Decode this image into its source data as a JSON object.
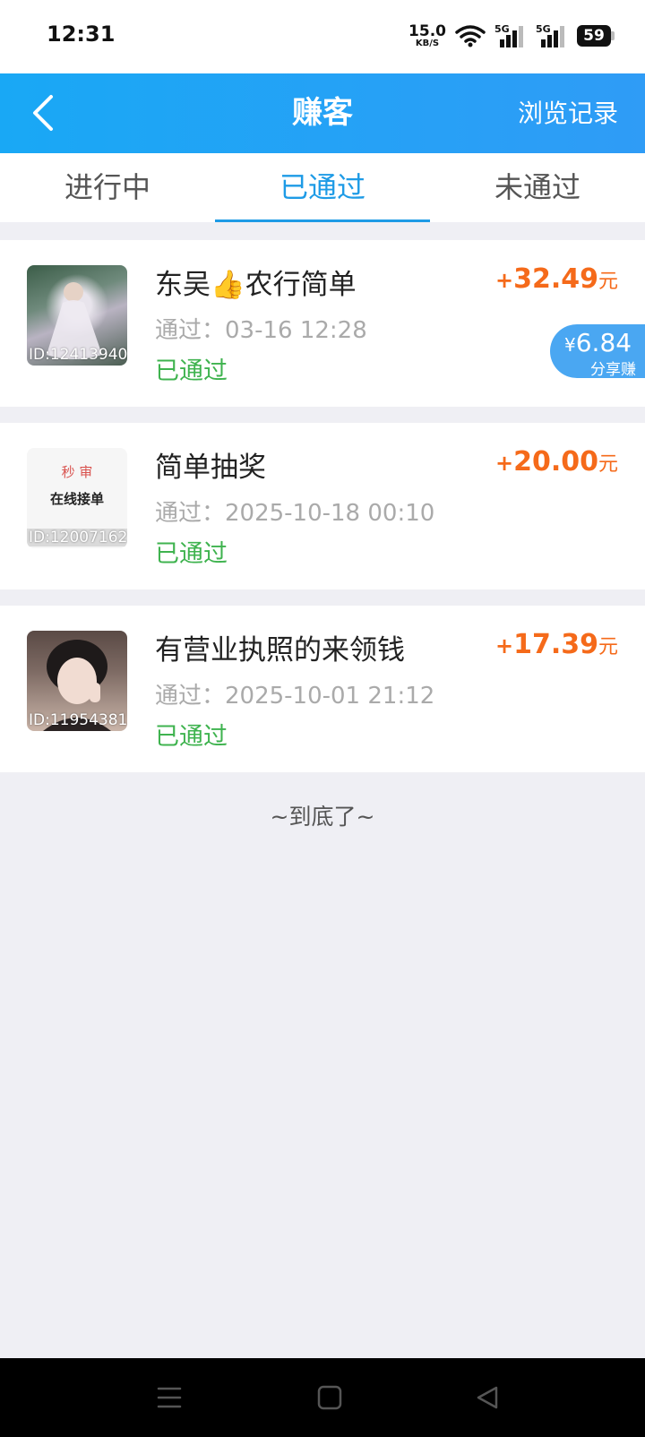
{
  "status_bar": {
    "time": "12:31",
    "net_speed": "15.0",
    "net_unit": "KB/S",
    "signal1_label": "5G",
    "signal2_label": "5G",
    "battery": "59"
  },
  "header": {
    "title": "赚客",
    "history_label": "浏览记录"
  },
  "tabs": [
    {
      "label": "进行中",
      "active": false
    },
    {
      "label": "已通过",
      "active": true
    },
    {
      "label": "未通过",
      "active": false
    }
  ],
  "items": [
    {
      "title": "东吴👍农行简单",
      "id_label": "ID:12413940",
      "time": "通过：03-16 12:28",
      "status": "已通过",
      "amount_sign": "+",
      "amount": "32.49",
      "unit": "元",
      "share": {
        "currency": "¥",
        "amount": "6.84",
        "label": "分享赚"
      }
    },
    {
      "title": "简单抽奖",
      "id_label": "ID:12007162",
      "thumb_text_top": "秒 审",
      "thumb_text_main": "在线接单",
      "time": "通过：2025-10-18 00:10",
      "status": "已通过",
      "amount_sign": "+",
      "amount": "20.00",
      "unit": "元"
    },
    {
      "title": "有营业执照的来领钱",
      "id_label": "ID:11954381",
      "time": "通过：2025-10-01 21:12",
      "status": "已通过",
      "amount_sign": "+",
      "amount": "17.39",
      "unit": "元"
    }
  ],
  "end_text": "~到底了~",
  "colors": {
    "header": "#1ea6f4",
    "tab_active": "#1e9be6",
    "amount": "#f56a1a",
    "status_passed": "#3fb34f",
    "share_badge": "#4aa7f2"
  },
  "icons": {
    "back": "chevron-left-icon",
    "wifi": "wifi-icon",
    "signal": "signal-icon",
    "battery": "battery-icon",
    "nav_menu": "menu-icon",
    "nav_home": "home-square-icon",
    "nav_back": "back-triangle-icon"
  }
}
